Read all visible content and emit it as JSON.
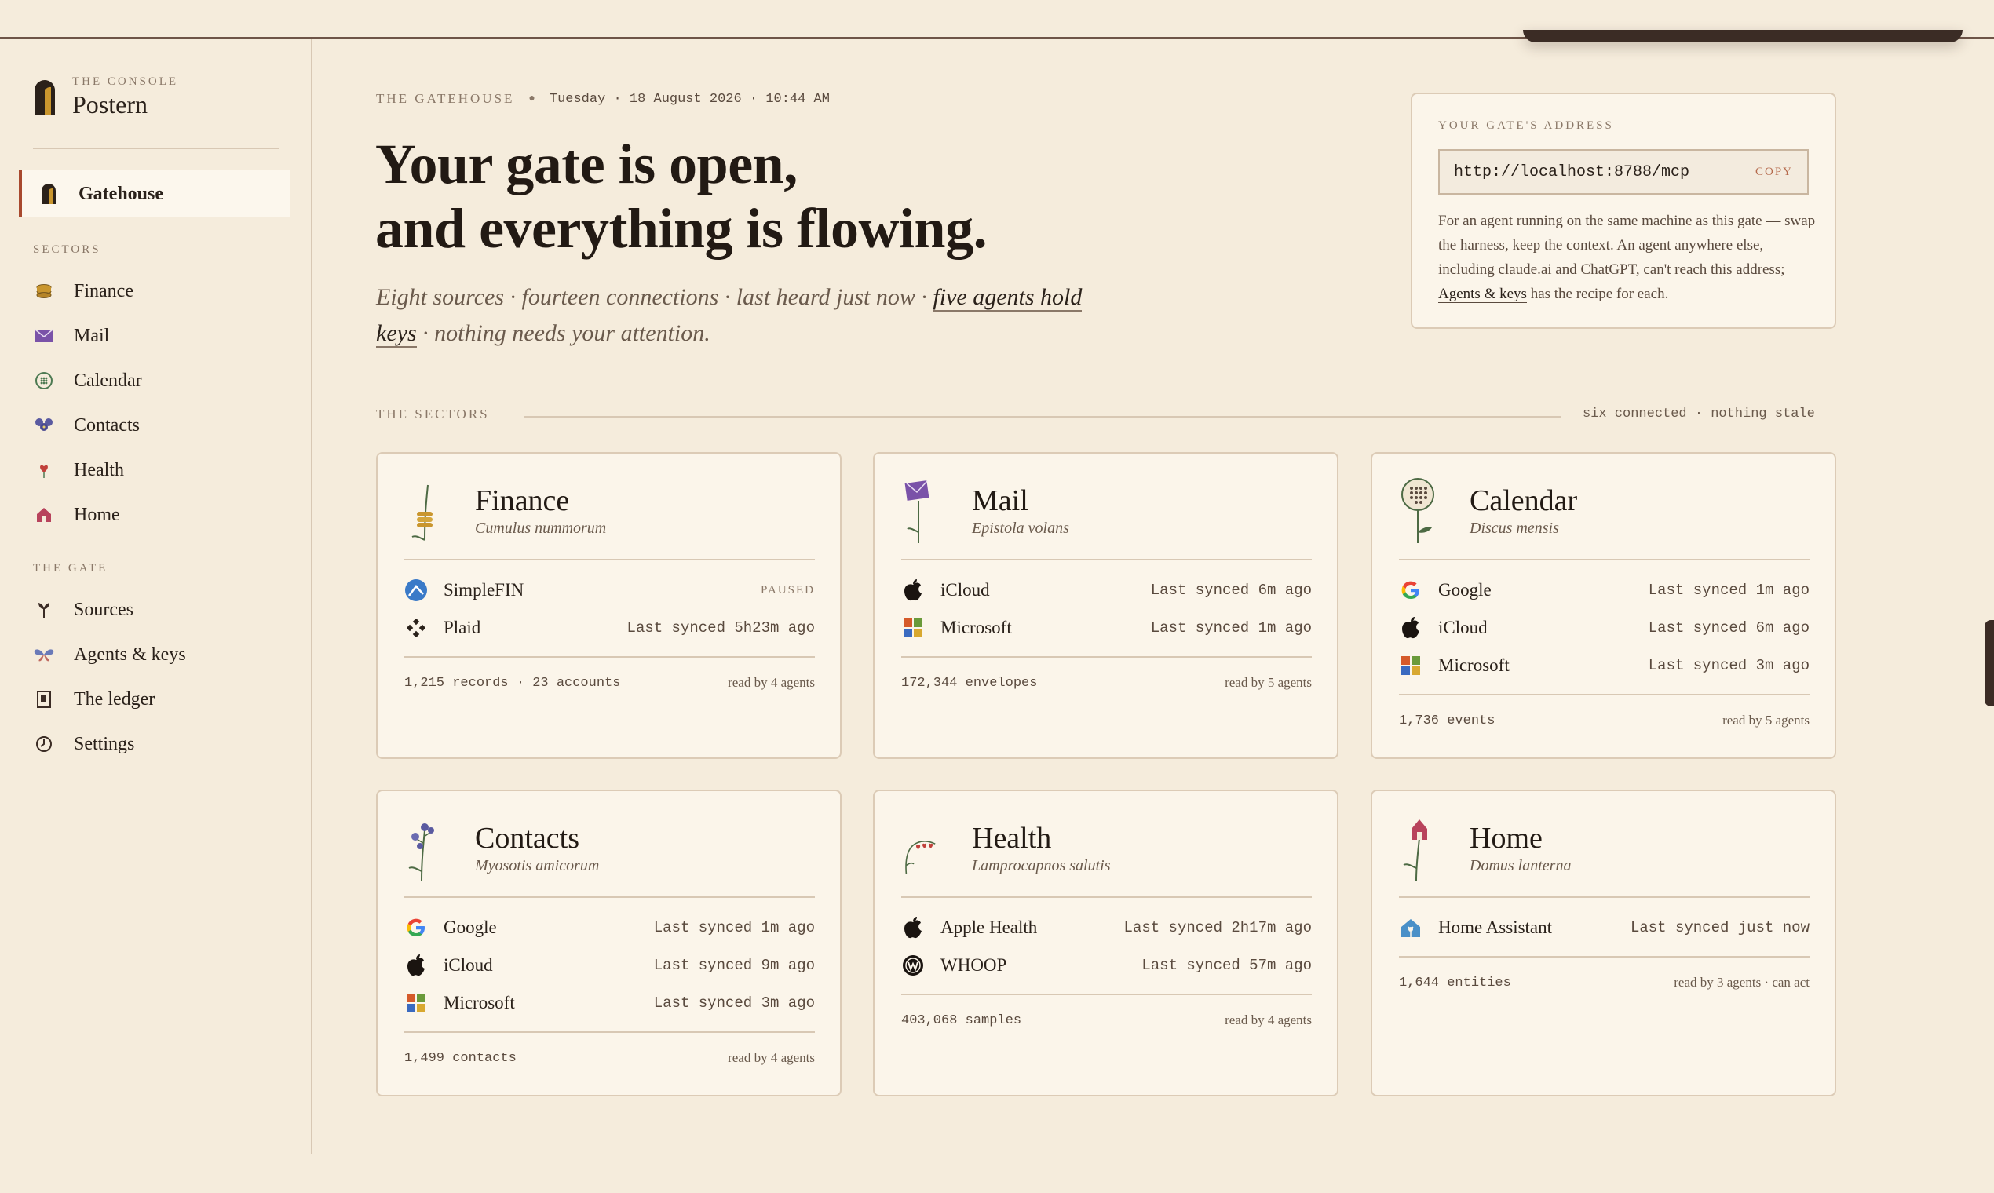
{
  "sidebar": {
    "kicker": "THE CONSOLE",
    "brand": "Postern",
    "active": {
      "label": "Gatehouse",
      "icon": "gate-icon"
    },
    "sectors_label": "SECTORS",
    "sectors": [
      {
        "label": "Finance",
        "icon": "coins-icon"
      },
      {
        "label": "Mail",
        "icon": "envelope-icon"
      },
      {
        "label": "Calendar",
        "icon": "calendar-wreath-icon"
      },
      {
        "label": "Contacts",
        "icon": "flower-cluster-icon"
      },
      {
        "label": "Health",
        "icon": "heart-flower-icon"
      },
      {
        "label": "Home",
        "icon": "house-icon"
      }
    ],
    "gate_label": "THE GATE",
    "gate": [
      {
        "label": "Sources",
        "icon": "sprout-icon"
      },
      {
        "label": "Agents & keys",
        "icon": "butterfly-icon"
      },
      {
        "label": "The ledger",
        "icon": "ledger-icon"
      },
      {
        "label": "Settings",
        "icon": "clock-gear-icon"
      }
    ]
  },
  "header": {
    "kicker": "THE GATEHOUSE",
    "datetime": "Tuesday · 18 August 2026 · 10:44 AM",
    "title_line1": "Your gate is open,",
    "title_line2": "and everything is flowing.",
    "sub_before": "Eight sources · fourteen connections · last heard just now · ",
    "sub_link": "five agents hold keys",
    "sub_after": " · nothing needs your attention."
  },
  "address": {
    "title": "YOUR GATE'S ADDRESS",
    "url": "http://localhost:8788/mcp",
    "copy": "COPY",
    "desc_before": "For an agent running on the same machine as this gate — swap the harness, keep the context. An agent anywhere else, including claude.ai and ChatGPT, can't reach this address; ",
    "desc_link": "Agents & keys",
    "desc_after": " has the recipe for each."
  },
  "sectors_header": {
    "title": "THE SECTORS",
    "note": "six connected · nothing stale"
  },
  "cards": [
    {
      "name": "Finance",
      "latin": "Cumulus nummorum",
      "sources": [
        {
          "name": "SimpleFIN",
          "status": "PAUSED",
          "icon": "simplefin-icon"
        },
        {
          "name": "Plaid",
          "status": "Last synced 5h23m ago",
          "icon": "plaid-icon"
        }
      ],
      "stat": "1,215 records · 23 accounts",
      "read": "read by 4 agents"
    },
    {
      "name": "Mail",
      "latin": "Epistola volans",
      "sources": [
        {
          "name": "iCloud",
          "status": "Last synced 6m ago",
          "icon": "apple-icon"
        },
        {
          "name": "Microsoft",
          "status": "Last synced 1m ago",
          "icon": "microsoft-icon"
        }
      ],
      "stat": "172,344 envelopes",
      "read": "read by 5 agents"
    },
    {
      "name": "Calendar",
      "latin": "Discus mensis",
      "sources": [
        {
          "name": "Google",
          "status": "Last synced 1m ago",
          "icon": "google-icon"
        },
        {
          "name": "iCloud",
          "status": "Last synced 6m ago",
          "icon": "apple-icon"
        },
        {
          "name": "Microsoft",
          "status": "Last synced 3m ago",
          "icon": "microsoft-icon"
        }
      ],
      "stat": "1,736 events",
      "read": "read by 5 agents"
    },
    {
      "name": "Contacts",
      "latin": "Myosotis amicorum",
      "sources": [
        {
          "name": "Google",
          "status": "Last synced 1m ago",
          "icon": "google-icon"
        },
        {
          "name": "iCloud",
          "status": "Last synced 9m ago",
          "icon": "apple-icon"
        },
        {
          "name": "Microsoft",
          "status": "Last synced 3m ago",
          "icon": "microsoft-icon"
        }
      ],
      "stat": "1,499 contacts",
      "read": "read by 4 agents"
    },
    {
      "name": "Health",
      "latin": "Lamprocapnos salutis",
      "sources": [
        {
          "name": "Apple Health",
          "status": "Last synced 2h17m ago",
          "icon": "apple-icon"
        },
        {
          "name": "WHOOP",
          "status": "Last synced 57m ago",
          "icon": "whoop-icon"
        }
      ],
      "stat": "403,068 samples",
      "read": "read by 4 agents"
    },
    {
      "name": "Home",
      "latin": "Domus lanterna",
      "sources": [
        {
          "name": "Home Assistant",
          "status": "Last synced just now",
          "icon": "home-assistant-icon"
        }
      ],
      "stat": "1,644 entities",
      "read": "read by 3 agents · can act"
    }
  ],
  "colors": {
    "background": "#f5ecdc",
    "card": "#fbf5ea",
    "accent": "#a8492e",
    "border": "#dccbb6"
  }
}
